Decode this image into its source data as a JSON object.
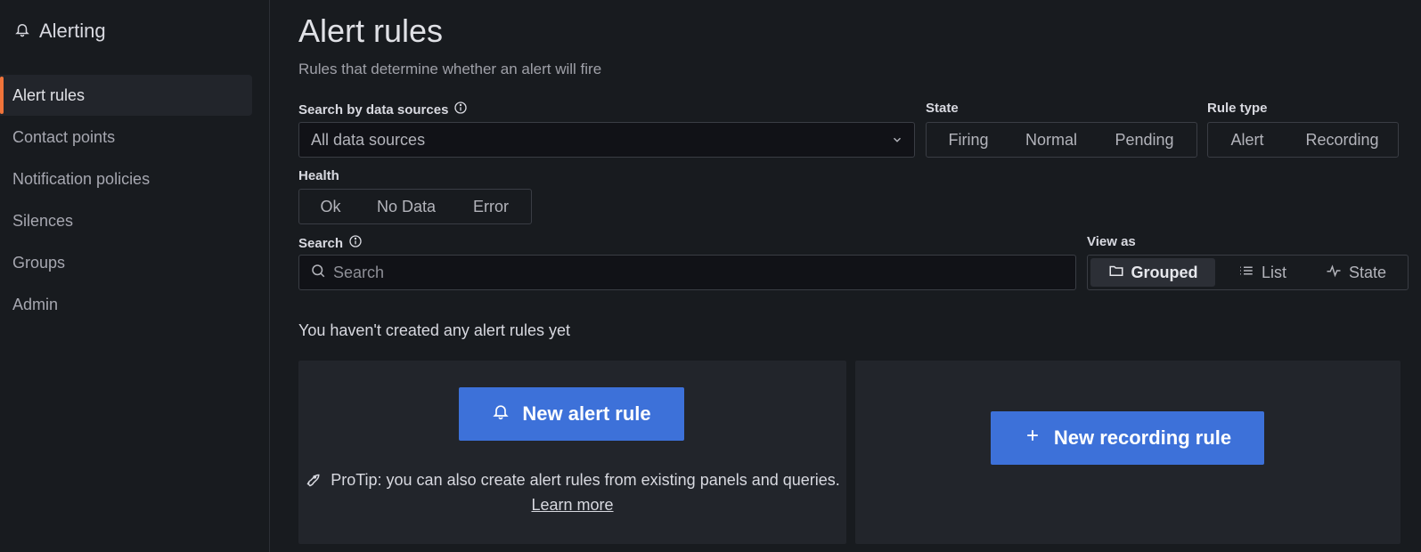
{
  "sidebar": {
    "title": "Alerting",
    "header_icon": "bell-icon",
    "items": [
      {
        "label": "Alert rules",
        "active": true
      },
      {
        "label": "Contact points",
        "active": false
      },
      {
        "label": "Notification policies",
        "active": false
      },
      {
        "label": "Silences",
        "active": false
      },
      {
        "label": "Groups",
        "active": false
      },
      {
        "label": "Admin",
        "active": false
      }
    ]
  },
  "header": {
    "title": "Alert rules",
    "subtitle": "Rules that determine whether an alert will fire"
  },
  "filters": {
    "datasource": {
      "label": "Search by data sources",
      "value": "All data sources"
    },
    "state": {
      "label": "State",
      "options": [
        "Firing",
        "Normal",
        "Pending"
      ]
    },
    "rule_type": {
      "label": "Rule type",
      "options": [
        "Alert",
        "Recording"
      ]
    },
    "health": {
      "label": "Health",
      "options": [
        "Ok",
        "No Data",
        "Error"
      ]
    },
    "search": {
      "label": "Search",
      "placeholder": "Search"
    },
    "view_as": {
      "label": "View as",
      "options": [
        "Grouped",
        "List",
        "State"
      ],
      "selected": "Grouped"
    }
  },
  "empty_state": {
    "message": "You haven't created any alert rules yet",
    "new_alert_label": "New alert rule",
    "new_recording_label": "New recording rule",
    "protip_text": "ProTip: you can also create alert rules from existing panels and queries.",
    "learn_more": "Learn more"
  },
  "colors": {
    "accent": "#3d71d9",
    "active_indicator": "#f0743a",
    "background": "#181b1f",
    "card": "#22252b"
  }
}
